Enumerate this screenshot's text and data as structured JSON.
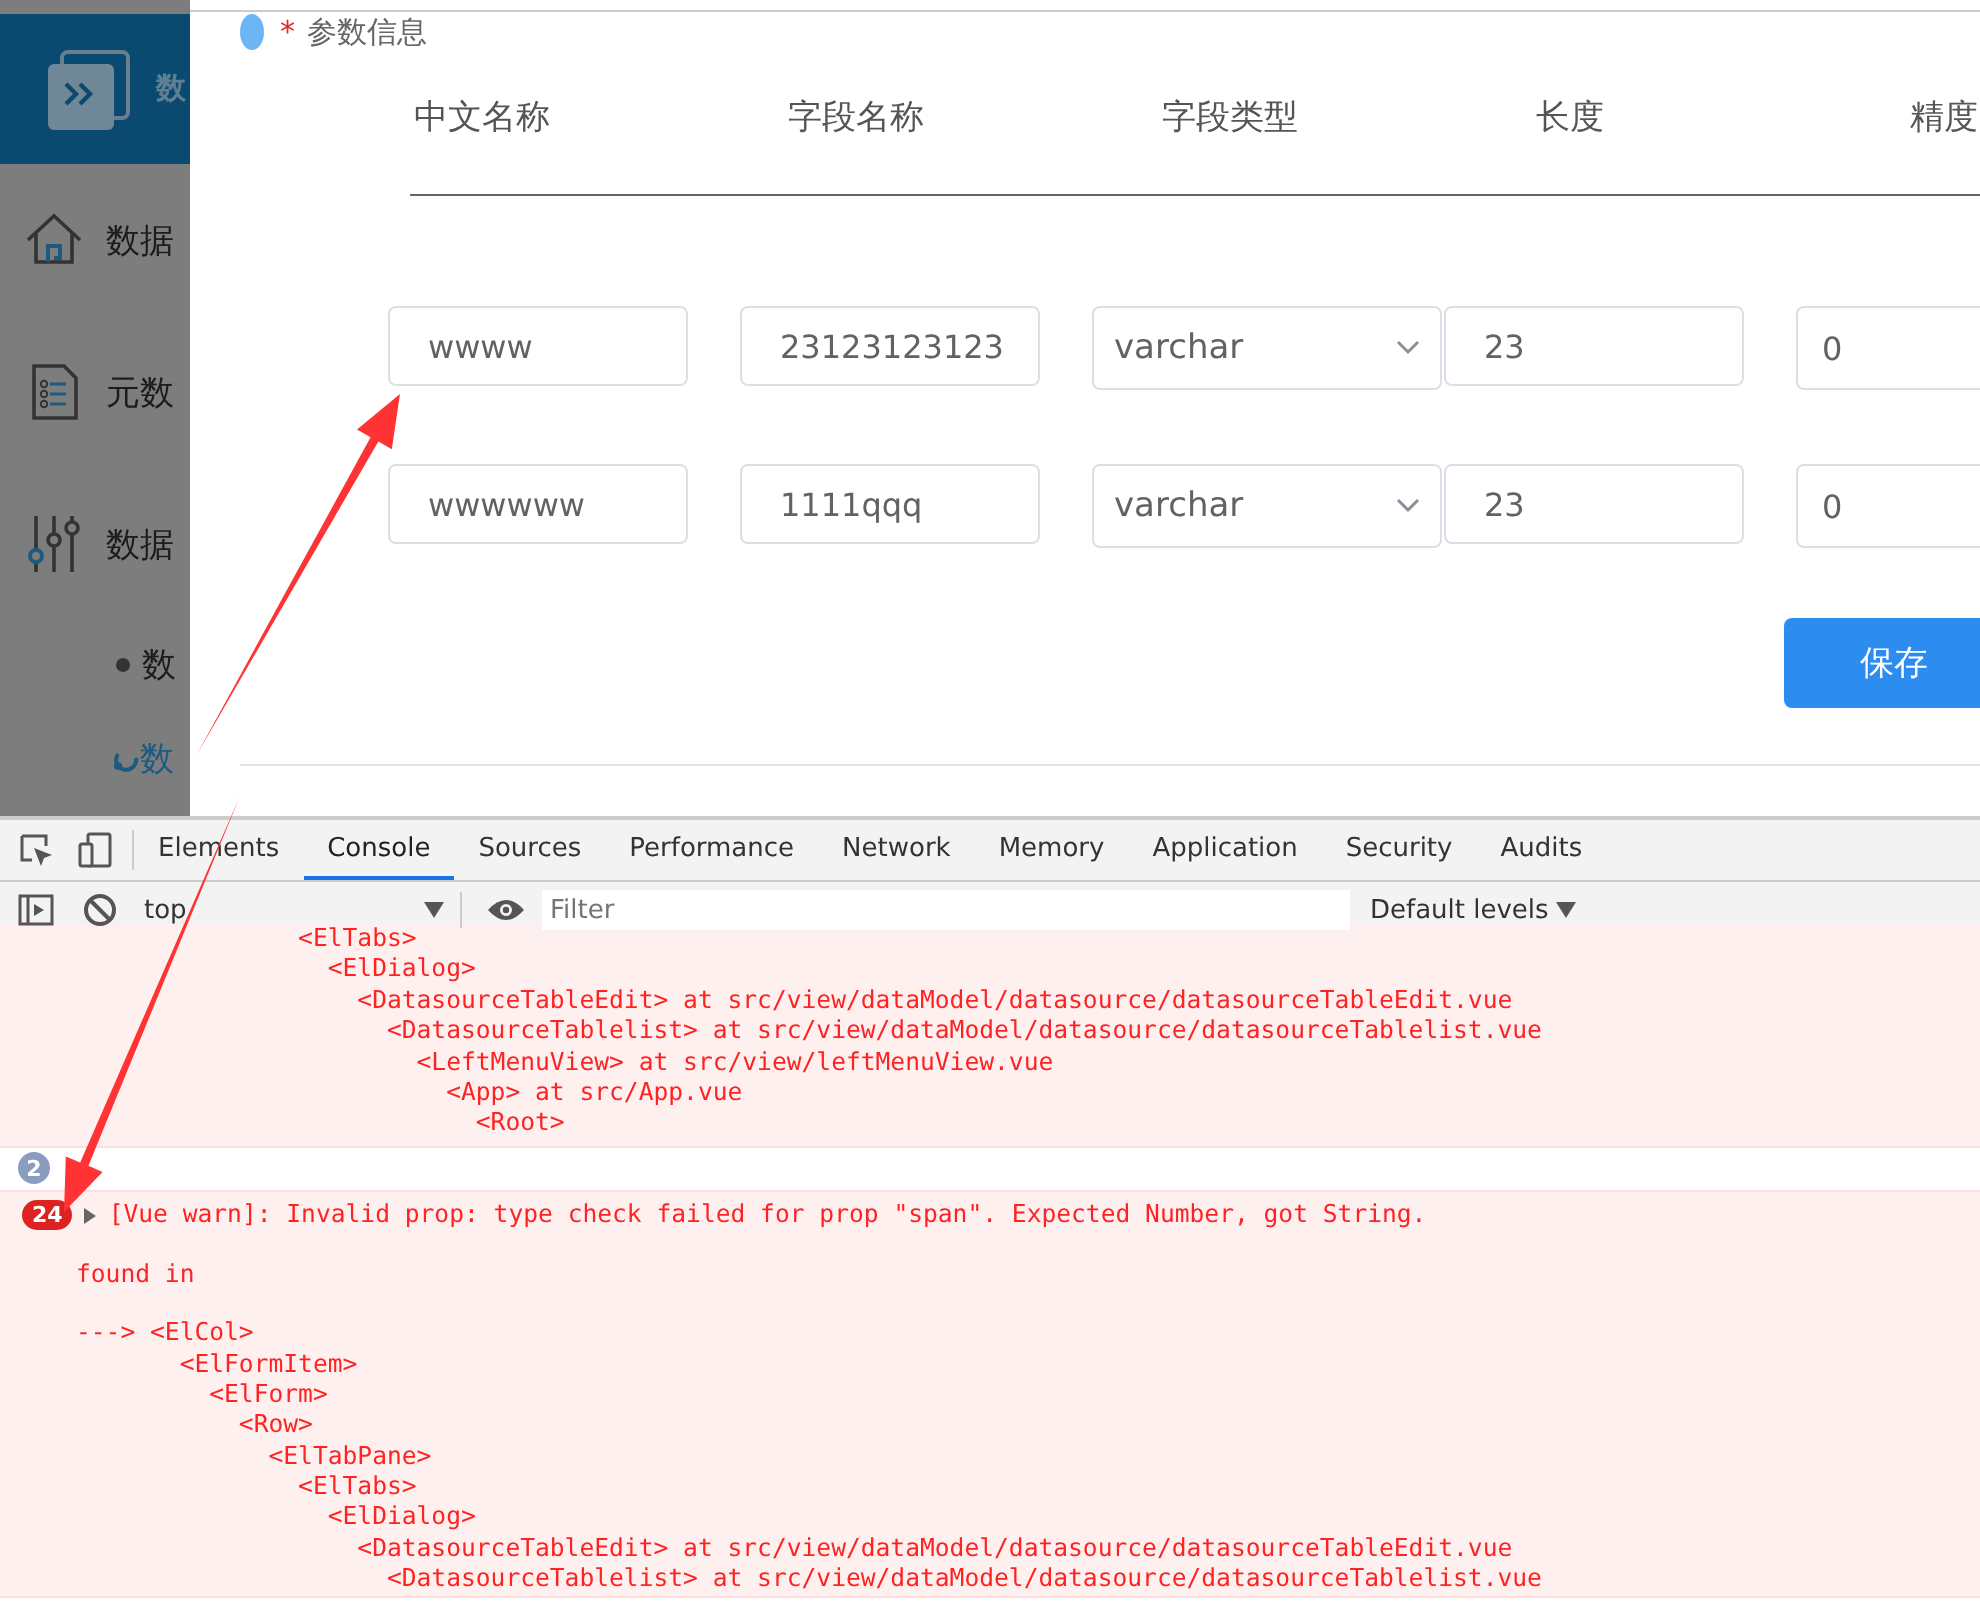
{
  "sidebar": {
    "title": "数",
    "items": [
      {
        "label": "数据"
      },
      {
        "label": "元数"
      },
      {
        "label": "数据"
      }
    ],
    "sub_item": "数",
    "link": "数"
  },
  "dialog": {
    "section": {
      "label": "参数信息",
      "required_mark": "*"
    },
    "columns": [
      "中文名称",
      "字段名称",
      "字段类型",
      "长度",
      "精度"
    ],
    "rows": [
      {
        "chinese_name": "wwww",
        "field_name": "23123123123",
        "field_type": "varchar",
        "length": "23",
        "precision": "0"
      },
      {
        "chinese_name": "wwwwww",
        "field_name": "1111qqq",
        "field_type": "varchar",
        "length": "23",
        "precision": "0"
      }
    ],
    "save_button": "保存"
  },
  "devtools": {
    "tabs": [
      {
        "label": "Elements",
        "selected": false
      },
      {
        "label": "Console",
        "selected": true
      },
      {
        "label": "Sources",
        "selected": false
      },
      {
        "label": "Performance",
        "selected": false
      },
      {
        "label": "Network",
        "selected": false
      },
      {
        "label": "Memory",
        "selected": false
      },
      {
        "label": "Application",
        "selected": false
      },
      {
        "label": "Security",
        "selected": false
      },
      {
        "label": "Audits",
        "selected": false
      }
    ],
    "toolbar": {
      "context": "top",
      "filter_placeholder": "Filter",
      "levels": "Default levels"
    },
    "messages": [
      {
        "kind": "trace",
        "lines": [
          "               <ElTabs>",
          "                 <ElDialog>",
          "                   <DatasourceTableEdit> at src/view/dataModel/datasource/datasourceTableEdit.vue",
          "                     <DatasourceTablelist> at src/view/dataModel/datasource/datasourceTablelist.vue",
          "                       <LeftMenuView> at src/view/leftMenuView.vue",
          "                         <App> at src/App.vue",
          "                           <Root>"
        ]
      },
      {
        "kind": "group",
        "count": "2"
      },
      {
        "kind": "warning",
        "count": "24",
        "expanded": false,
        "text": "[Vue warn]: Invalid prop: type check failed for prop \"span\". Expected Number, got String.",
        "found_in": "found in",
        "lines": [
          "---> <ElCol>",
          "       <ElFormItem>",
          "         <ElForm>",
          "           <Row>",
          "             <ElTabPane>",
          "               <ElTabs>",
          "                 <ElDialog>",
          "                   <DatasourceTableEdit> at src/view/dataModel/datasource/datasourceTableEdit.vue",
          "                     <DatasourceTablelist> at src/view/dataModel/datasource/datasourceTablelist.vue"
        ]
      }
    ]
  }
}
